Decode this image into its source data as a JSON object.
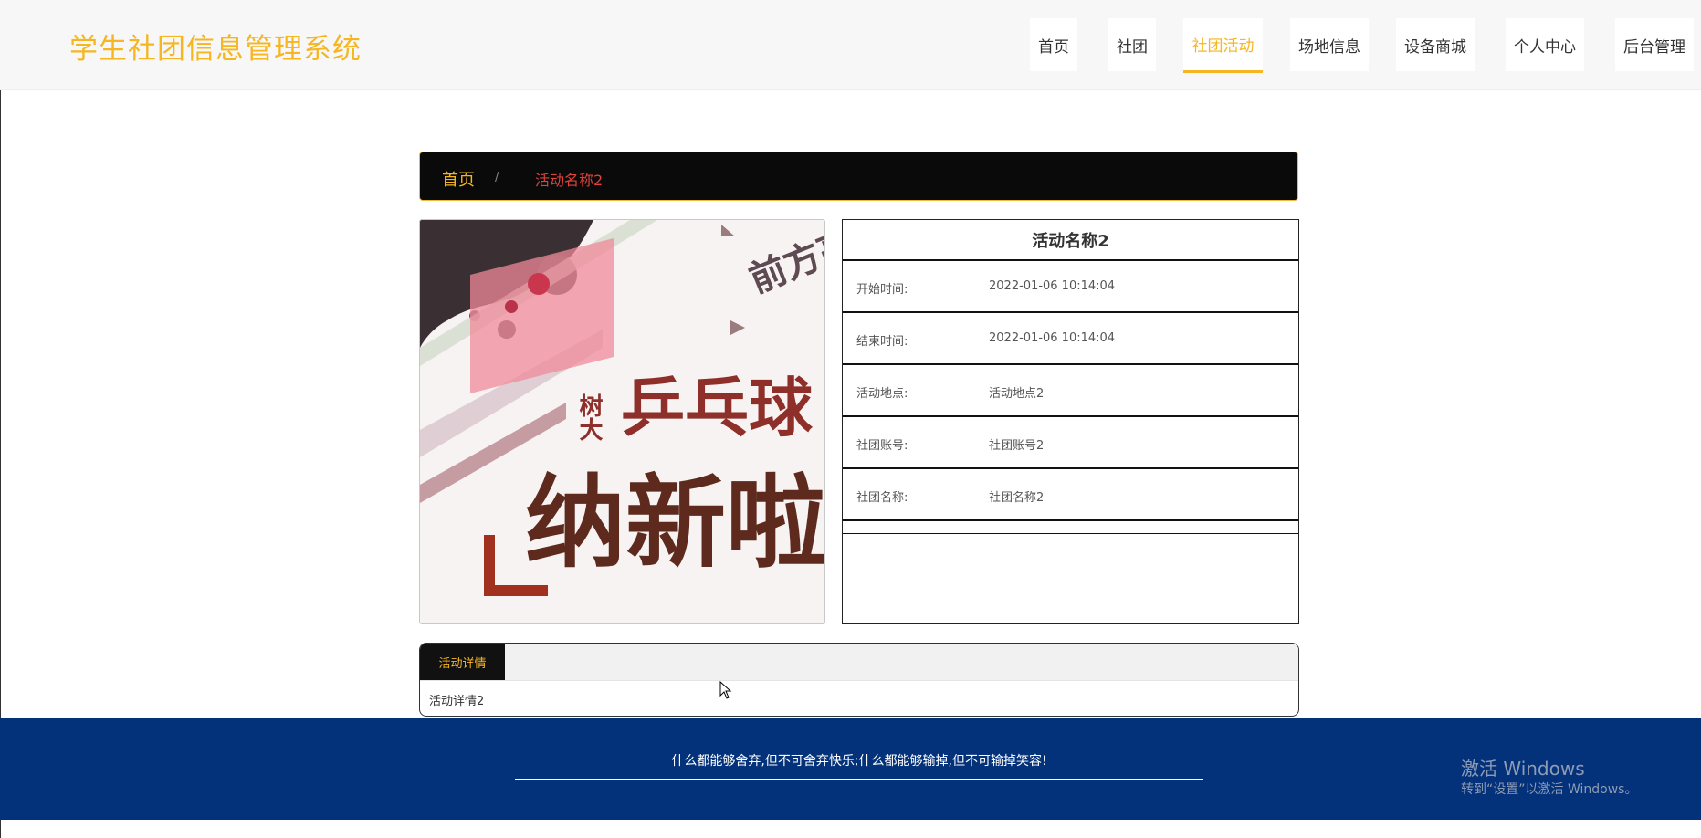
{
  "header": {
    "logo": "学生社团信息管理系统",
    "nav": [
      {
        "label": "首页",
        "active": false
      },
      {
        "label": "社团",
        "active": false
      },
      {
        "label": "社团活动",
        "active": true
      },
      {
        "label": "场地信息",
        "active": false
      },
      {
        "label": "设备商城",
        "active": false
      },
      {
        "label": "个人中心",
        "active": false
      },
      {
        "label": "后台管理",
        "active": false
      }
    ]
  },
  "breadcrumb": {
    "home": "首页",
    "separator": "/",
    "current": "活动名称2"
  },
  "poster": {
    "text_small": "树大",
    "text_top": "前方高",
    "text_mid": "乒乓球",
    "text_big": "纳新啦"
  },
  "info": {
    "title": "活动名称2",
    "rows": [
      {
        "label": "开始时间:",
        "value": "2022-01-06 10:14:04"
      },
      {
        "label": "结束时间:",
        "value": "2022-01-06 10:14:04"
      },
      {
        "label": "活动地点:",
        "value": "活动地点2"
      },
      {
        "label": "社团账号:",
        "value": "社团账号2"
      },
      {
        "label": "社团名称:",
        "value": "社团名称2"
      }
    ]
  },
  "details": {
    "tab_label": "活动详情",
    "content": "活动详情2"
  },
  "footer": {
    "slogan": "什么都能够舍弃,但不可舍弃快乐;什么都能够输掉,但不可输掉笑容!"
  },
  "watermark": {
    "title": "激活 Windows",
    "subtitle": "转到“设置”以激活 Windows。"
  },
  "colors": {
    "accent": "#f5b622",
    "breadcrumb_current": "#e0413b",
    "footer_bg": "#04327a",
    "dark": "#0a0a0a"
  }
}
